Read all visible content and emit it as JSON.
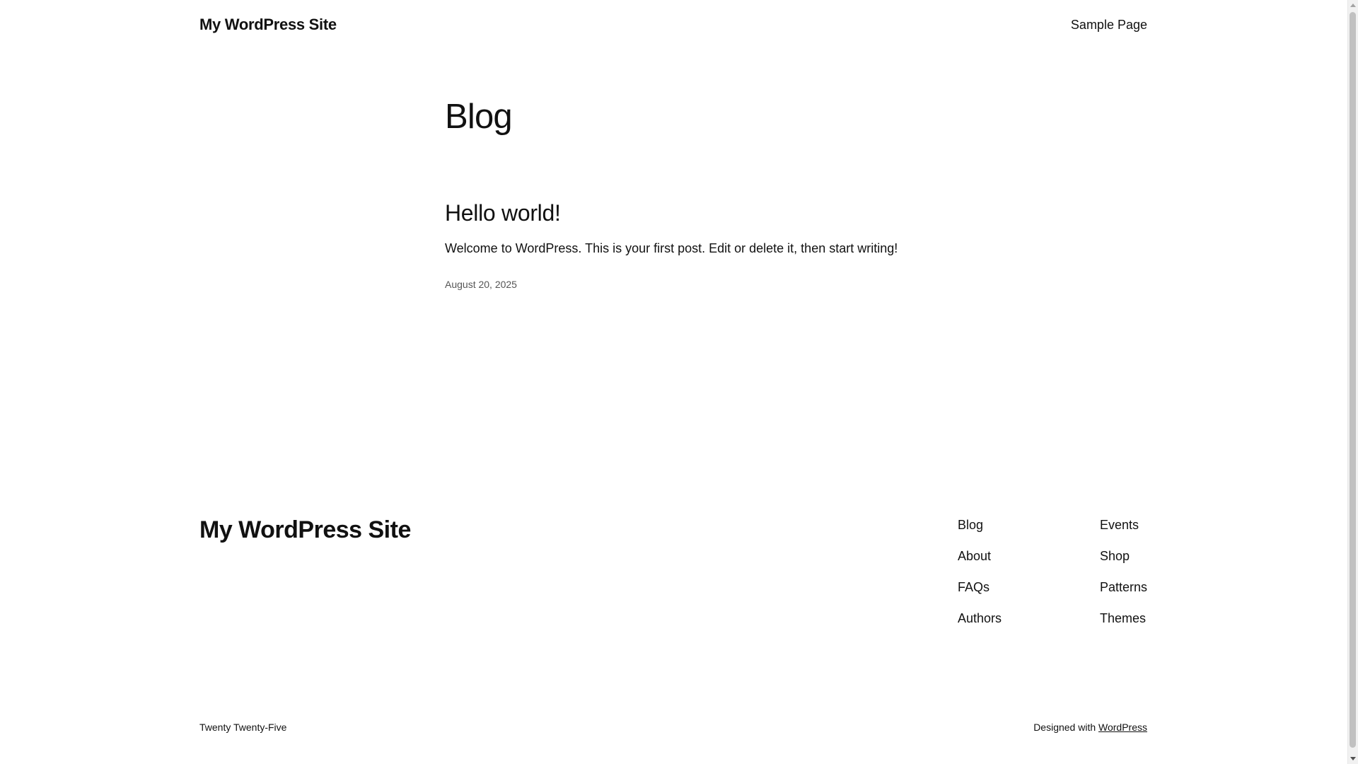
{
  "header": {
    "site_title": "My WordPress Site",
    "nav": [
      "Sample Page"
    ]
  },
  "main": {
    "heading": "Blog",
    "posts": [
      {
        "title": "Hello world!",
        "excerpt": "Welcome to WordPress. This is your first post. Edit or delete it, then start writing!",
        "date": "August 20, 2025"
      }
    ]
  },
  "footer": {
    "site_title": "My WordPress Site",
    "nav_col1": [
      "Blog",
      "About",
      "FAQs",
      "Authors"
    ],
    "nav_col2": [
      "Events",
      "Shop",
      "Patterns",
      "Themes"
    ],
    "theme_name": "Twenty Twenty-Five",
    "credit_prefix": "Designed with ",
    "credit_link": "WordPress"
  }
}
